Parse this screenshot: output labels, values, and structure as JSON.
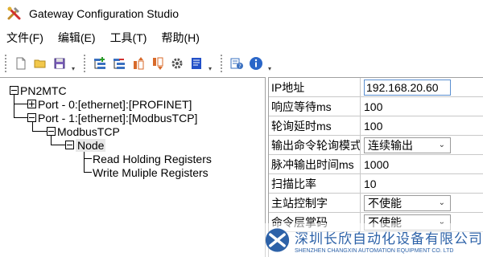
{
  "window": {
    "title": "Gateway Configuration Studio"
  },
  "menu": [
    {
      "label": "文件(F)"
    },
    {
      "label": "编辑(E)"
    },
    {
      "label": "工具(T)"
    },
    {
      "label": "帮助(H)"
    }
  ],
  "toolbar": {
    "groups": [
      [
        "new-file-icon",
        "open-folder-icon",
        "save-icon"
      ],
      [
        "add-item-icon",
        "remove-item-icon",
        "upload-icon",
        "download-icon",
        "gear-icon",
        "blue-document-icon"
      ],
      [
        "config-help-icon",
        "info-icon"
      ]
    ]
  },
  "tree": {
    "root": "PN2MTC",
    "port0": "Port - 0:[ethernet]:[PROFINET]",
    "port1": "Port - 1:[ethernet]:[ModbusTCP]",
    "modbus": "ModbusTCP",
    "node": "Node",
    "read": "Read Holding Registers",
    "write": "Write Muliple Registers"
  },
  "properties": [
    {
      "name": "IP地址",
      "value": "192.168.20.60",
      "kind": "input"
    },
    {
      "name": "响应等待ms",
      "value": "100",
      "kind": "text"
    },
    {
      "name": "轮询延时ms",
      "value": "100",
      "kind": "text"
    },
    {
      "name": "输出命令轮询模式",
      "value": "连续输出",
      "kind": "select"
    },
    {
      "name": "脉冲输出时间ms",
      "value": "1000",
      "kind": "text"
    },
    {
      "name": "扫描比率",
      "value": "10",
      "kind": "text"
    },
    {
      "name": "主站控制字",
      "value": "不使能",
      "kind": "select"
    },
    {
      "name": "命令层掌码",
      "value": "不使能",
      "kind": "select"
    }
  ],
  "watermark": {
    "cn": "深圳长欣自动化设备有限公司",
    "en": "SHENZHEN CHANGXIN AUTOMATION EQUIPMENT CO. LTD"
  },
  "colors": {
    "accent": "#2d62a8",
    "input_border": "#5a8fd0"
  }
}
